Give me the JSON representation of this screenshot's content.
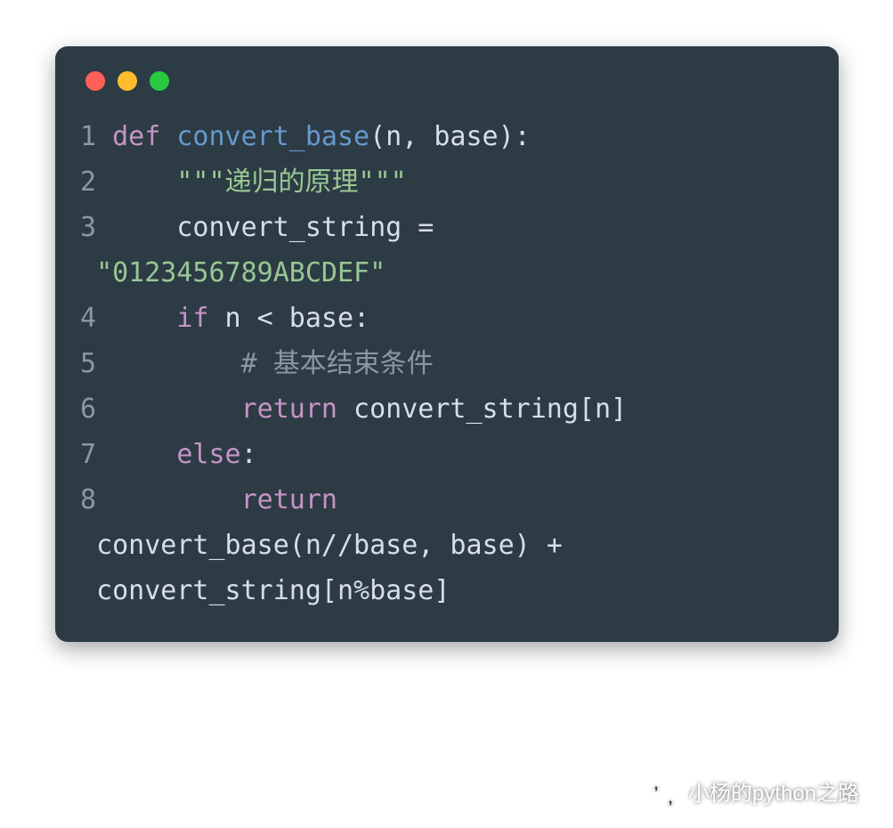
{
  "colors": {
    "window_bg": "#2d3b45",
    "keyword": "#c594c5",
    "function": "#6699cc",
    "identifier": "#d8dee9",
    "string": "#99c794",
    "comment": "#8b97a4",
    "line_number": "#8b97a4",
    "traffic_red": "#ff5f56",
    "traffic_yellow": "#ffbd2e",
    "traffic_green": "#27c93f"
  },
  "code": {
    "lines": [
      {
        "n": "1",
        "tokens": [
          {
            "t": "def ",
            "c": "kw"
          },
          {
            "t": "convert_base",
            "c": "fn"
          },
          {
            "t": "(n, base):",
            "c": "id"
          }
        ]
      },
      {
        "n": "2",
        "indent": "    ",
        "tokens": [
          {
            "t": "\"\"\"递归的原理\"\"\"",
            "c": "str"
          }
        ]
      },
      {
        "n": "3",
        "indent": "    ",
        "tokens": [
          {
            "t": "convert_string = ",
            "c": "id"
          }
        ]
      },
      {
        "cont": true,
        "tokens": [
          {
            "t": "\"0123456789ABCDEF\"",
            "c": "str"
          }
        ]
      },
      {
        "n": "4",
        "indent": "    ",
        "tokens": [
          {
            "t": "if",
            "c": "kw"
          },
          {
            "t": " n < base:",
            "c": "id"
          }
        ]
      },
      {
        "n": "5",
        "indent": "        ",
        "tokens": [
          {
            "t": "# 基本结束条件",
            "c": "cmt"
          }
        ]
      },
      {
        "n": "6",
        "indent": "        ",
        "tokens": [
          {
            "t": "return",
            "c": "kw"
          },
          {
            "t": " convert_string[n]",
            "c": "id"
          }
        ]
      },
      {
        "n": "7",
        "indent": "    ",
        "tokens": [
          {
            "t": "else",
            "c": "kw"
          },
          {
            "t": ":",
            "c": "id"
          }
        ]
      },
      {
        "n": "8",
        "indent": "        ",
        "tokens": [
          {
            "t": "return",
            "c": "kw"
          },
          {
            "t": " ",
            "c": "id"
          }
        ]
      },
      {
        "cont": true,
        "tokens": [
          {
            "t": "convert_base(n//base, base) + ",
            "c": "id"
          }
        ]
      },
      {
        "cont": true,
        "tokens": [
          {
            "t": "convert_string[n%base]",
            "c": "id"
          }
        ]
      }
    ]
  },
  "watermark": {
    "text": "小杨的python之路",
    "icon": "wechat-icon"
  }
}
